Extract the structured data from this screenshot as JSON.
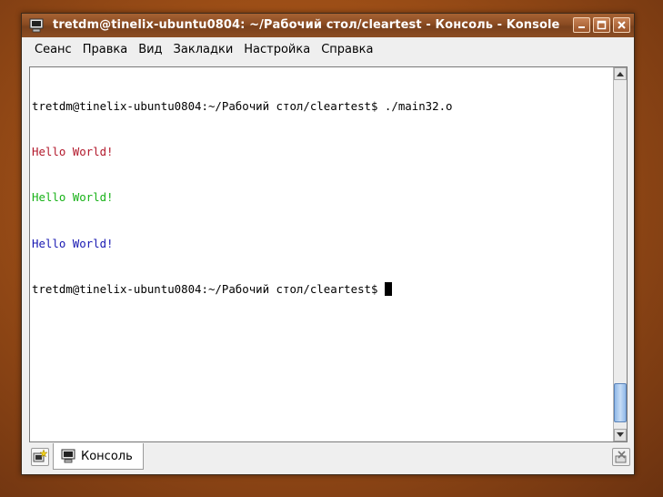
{
  "window": {
    "title": "tretdm@tinelix-ubuntu0804: ~/Рабочий стол/cleartest - Консоль - Konsole",
    "buttons": [
      "minimize-icon",
      "maximize-icon",
      "close-icon"
    ]
  },
  "menu": {
    "items": [
      "Сеанс",
      "Правка",
      "Вид",
      "Закладки",
      "Настройка",
      "Справка"
    ]
  },
  "terminal": {
    "lines": [
      {
        "text": "tretdm@tinelix-ubuntu0804:~/Рабочий стол/cleartest$ ./main32.o",
        "color": "#000000"
      },
      {
        "text": "Hello World!",
        "color": "#b2182b"
      },
      {
        "text": "Hello World!",
        "color": "#18b218"
      },
      {
        "text": "Hello World!",
        "color": "#1818b2"
      },
      {
        "text": "tretdm@tinelix-ubuntu0804:~/Рабочий стол/cleartest$ ",
        "color": "#000000"
      }
    ]
  },
  "tabs": [
    {
      "label": "Консоль",
      "icon": "konsole-icon"
    }
  ],
  "colors": {
    "title_bar": "#8a4b22",
    "scroll_thumb": "#8fb8e8"
  }
}
